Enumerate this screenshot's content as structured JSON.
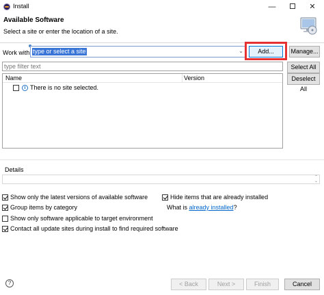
{
  "window": {
    "title": "Install",
    "minimize": "—",
    "close": "✕"
  },
  "header": {
    "title": "Available Software",
    "subtitle": "Select a site or enter the location of a site."
  },
  "work_with": {
    "label": "Work with:",
    "value": "type or select a site",
    "add_label": "Add...",
    "manage_label": "Manage..."
  },
  "filter": {
    "placeholder": "type filter text",
    "select_all_label": "Select All",
    "deselect_all_label": "Deselect All"
  },
  "tree": {
    "columns": [
      "Name",
      "Version"
    ],
    "rows": [
      {
        "text": "There is no site selected.",
        "checked": false
      }
    ]
  },
  "details": {
    "label": "Details"
  },
  "options": [
    {
      "label": "Show only the latest versions of available software",
      "checked": true
    },
    {
      "label": "Group items by category",
      "checked": true
    },
    {
      "label": "Show only software applicable to target environment",
      "checked": false
    },
    {
      "label": "Contact all update sites during install to find required software",
      "checked": true
    },
    {
      "label": "Hide items that are already installed",
      "checked": true
    }
  ],
  "what_is": {
    "prefix": "What is ",
    "link": "already installed",
    "suffix": "?"
  },
  "footer": {
    "back_label": "< Back",
    "next_label": "Next >",
    "finish_label": "Finish",
    "cancel_label": "Cancel"
  },
  "colors": {
    "highlight": "#e53131",
    "selection": "#3875d7",
    "link": "#0066cc"
  }
}
